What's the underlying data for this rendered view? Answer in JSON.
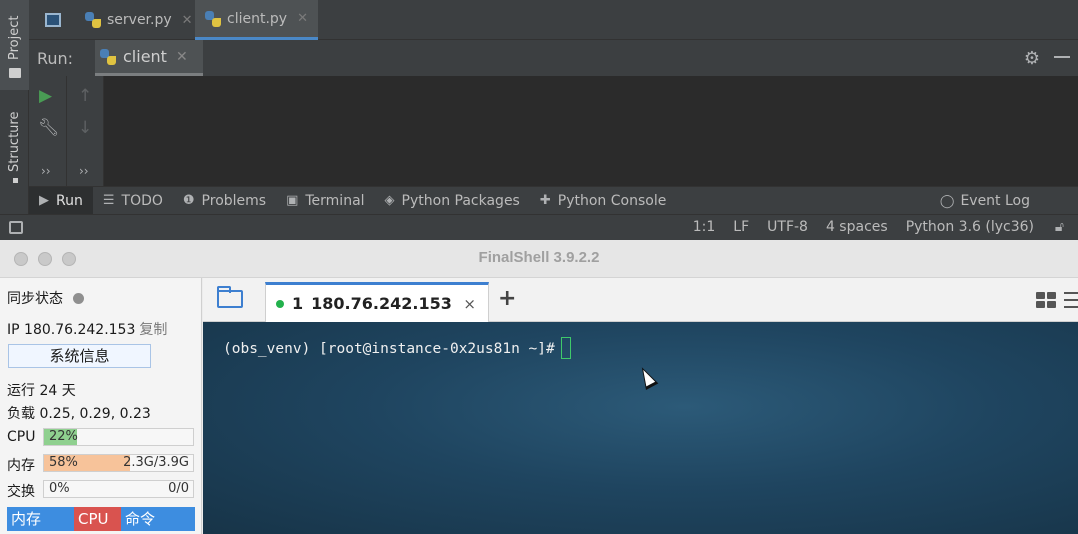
{
  "ide": {
    "side_tabs": {
      "project": "Project",
      "structure": "Structure"
    },
    "editor_tabs": [
      {
        "label": "server.py",
        "active": false
      },
      {
        "label": "client.py",
        "active": true
      }
    ],
    "run_panel": {
      "label": "Run:",
      "tab": "client"
    },
    "tool_windows": {
      "run": "Run",
      "todo": "TODO",
      "problems": "Problems",
      "terminal": "Terminal",
      "python_packages": "Python Packages",
      "python_console": "Python Console",
      "event_log": "Event Log"
    },
    "status": {
      "position": "1:1",
      "line_sep": "LF",
      "encoding": "UTF-8",
      "indent": "4 spaces",
      "interpreter": "Python 3.6 (lyc36)"
    },
    "colors": {
      "accent": "#4a88c7",
      "run_green": "#499c54"
    }
  },
  "finalshell": {
    "title": "FinalShell 3.9.2.2",
    "sidebar": {
      "sync_status": "同步状态",
      "ip_label": "IP",
      "ip": "180.76.242.153",
      "copy": "复制",
      "sysinfo_button": "系统信息",
      "uptime_label": "运行",
      "uptime": "24 天",
      "load_label": "负载",
      "load": "0.25, 0.29, 0.23",
      "cpu_label": "CPU",
      "cpu_percent": "22%",
      "cpu_fraction": 0.22,
      "mem_label": "内存",
      "mem_percent": "58%",
      "mem_usage": "2.3G/3.9G",
      "mem_fraction": 0.58,
      "swap_label": "交换",
      "swap_percent": "0%",
      "swap_usage": "0/0",
      "swap_fraction": 0.0,
      "proc_headers": [
        "内存",
        "CPU",
        "命令"
      ]
    },
    "session_tab": {
      "index": "1",
      "host": "180.76.242.153",
      "close": "×"
    },
    "add_tab": "+",
    "terminal": {
      "prompt": "(obs_venv) [root@instance-0x2us81n ~]#"
    },
    "colors": {
      "cpu_fill": "#8fd08f",
      "mem_fill": "#f7c39a",
      "proc_mem": "#3d8de0",
      "proc_cpu": "#d9534f",
      "proc_cmd": "#3d8de0",
      "session_dot": "#22b14c"
    }
  }
}
